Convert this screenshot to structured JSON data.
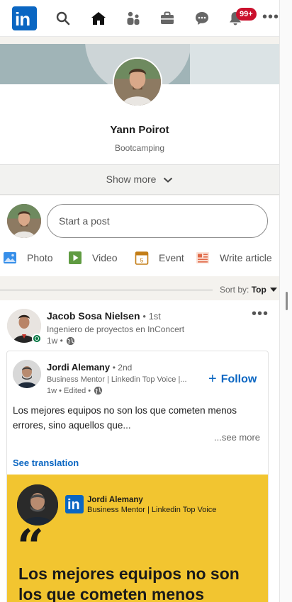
{
  "nav": {
    "logo_text": "in",
    "notifications_badge": "99+",
    "more_label": "•••"
  },
  "profile": {
    "name": "Yann Poirot",
    "subtitle": "Bootcamping",
    "show_more": "Show more"
  },
  "composer": {
    "placeholder": "Start a post",
    "actions": [
      {
        "label": "Photo",
        "icon": "photo-icon",
        "color": "#378fe9"
      },
      {
        "label": "Video",
        "icon": "video-icon",
        "color": "#5f9b41"
      },
      {
        "label": "Event",
        "icon": "event-icon",
        "color": "#c37d16"
      },
      {
        "label": "Write article",
        "icon": "article-icon",
        "color": "#e06847"
      }
    ]
  },
  "feed": {
    "sort_label": "Sort by:",
    "sort_value": "Top"
  },
  "post": {
    "actor_name": "Jacob Sosa Nielsen",
    "actor_degree": "• 1st",
    "actor_description": "Ingeniero de proyectos en InConcert",
    "actor_time": "1w •",
    "menu": "•••",
    "shared": {
      "author_name": "Jordi Alemany",
      "author_degree": "• 2nd",
      "author_description": "Business Mentor | Linkedin Top Voice |...",
      "time": "1w • Edited •",
      "follow_plus": "+",
      "follow_label": "Follow",
      "text": "Los mejores equipos no son los que cometen menos errores, sino aquellos que...",
      "see_more": "...see more",
      "see_translation": "See translation",
      "image": {
        "logo_text": "in",
        "name": "Jordi Alemany",
        "role": "Business Mentor | Linkedin Top Voice",
        "quote_mark": "“",
        "headline": "Los mejores equipos no son los que cometen menos"
      }
    }
  },
  "colors": {
    "brand": "#0a66c2",
    "badge": "#cb112d",
    "online": "#057642",
    "image_bg": "#f2c530"
  }
}
